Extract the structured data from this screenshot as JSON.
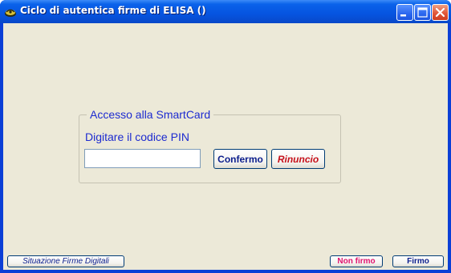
{
  "window": {
    "title": "Ciclo di autentica firme di ELISA ()",
    "colors": {
      "titlebar": "#0654e0",
      "client_background": "#ece9d8",
      "label_blue": "#1d2bd0",
      "rinuncio_red": "#c6101a",
      "nonfirmo_pink": "#e0136e",
      "close_button": "#e2583a"
    },
    "controls": {
      "minimize_icon": "minimize-icon",
      "maximize_icon": "maximize-icon",
      "close_icon": "close-icon"
    }
  },
  "smartcard": {
    "group_title": "Accesso alla SmartCard",
    "pin_label": "Digitare il codice PIN",
    "pin_value": "",
    "confirm_label": "Confermo",
    "cancel_label": "Rinuncio"
  },
  "footer": {
    "status_button_label": "Situazione Firme Digitali",
    "nonfirmo_label": "Non firmo",
    "firmo_label": "Firmo"
  }
}
